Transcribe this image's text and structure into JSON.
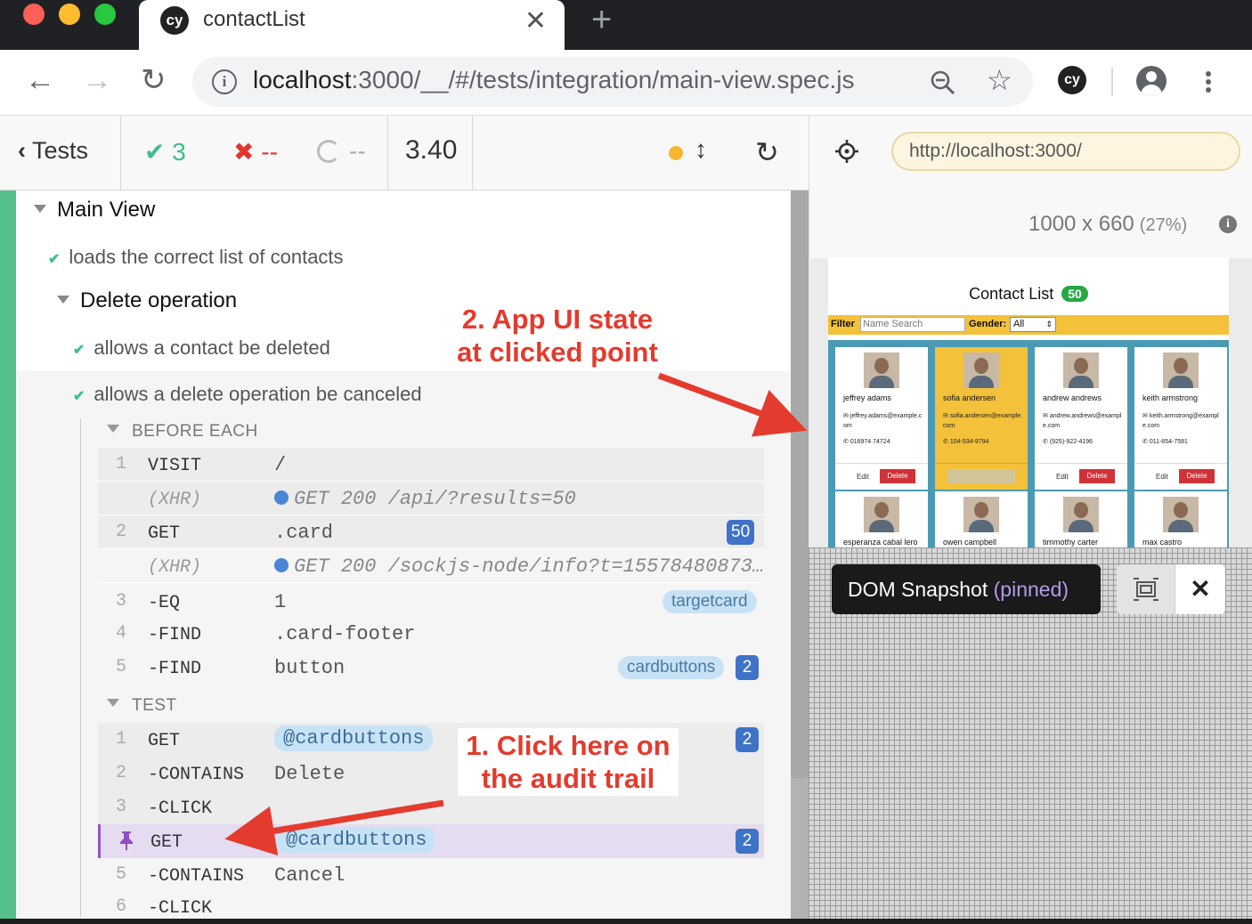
{
  "browser": {
    "tab_title": "contactList",
    "tab_favicon": "cy",
    "tab_close": "✕",
    "new_tab": "+",
    "url_host": "localhost",
    "url_path": ":3000/__/#/tests/integration/main-view.spec.js",
    "extension_label": "cy"
  },
  "runner": {
    "back_label": "Tests",
    "passed": "3",
    "failed": "--",
    "pending": "--",
    "duration": "3.40",
    "suite": "Main View",
    "tests": [
      {
        "title": "loads the correct list of contacts"
      },
      {
        "title": "allows a contact be deleted"
      },
      {
        "title": "allows a delete operation be canceled"
      }
    ],
    "nested_suite": "Delete operation",
    "before_each_label": "BEFORE EACH",
    "test_label": "TEST",
    "before_each_commands": [
      {
        "num": "1",
        "name": "VISIT",
        "message": "/"
      },
      {
        "num": "",
        "name": "(XHR)",
        "message": "GET 200 /api/?results=50"
      },
      {
        "num": "2",
        "name": "GET",
        "message": ".card",
        "badge": "50"
      },
      {
        "num": "",
        "name": "(XHR)",
        "message": "GET 200 /sockjs-node/info?t=15578480873…"
      },
      {
        "num": "3",
        "name": "-EQ",
        "message": "1",
        "alias": "targetcard"
      },
      {
        "num": "4",
        "name": "-FIND",
        "message": ".card-footer"
      },
      {
        "num": "5",
        "name": "-FIND",
        "message": "button",
        "alias": "cardbuttons",
        "badge": "2"
      }
    ],
    "test_commands": [
      {
        "num": "1",
        "name": "GET",
        "message": "@cardbuttons",
        "badge": "2"
      },
      {
        "num": "2",
        "name": "-CONTAINS",
        "message": "Delete"
      },
      {
        "num": "3",
        "name": "-CLICK",
        "message": ""
      },
      {
        "num": "",
        "name": "GET",
        "message": "@cardbuttons",
        "badge": "2",
        "pinned": true
      },
      {
        "num": "5",
        "name": "-CONTAINS",
        "message": "Cancel"
      },
      {
        "num": "6",
        "name": "-CLICK",
        "message": ""
      }
    ]
  },
  "aut": {
    "url": "http://localhost:3000/",
    "viewport": "1000 x 660",
    "scale": "(27%)",
    "snapshot_label": "DOM Snapshot",
    "snapshot_pinned": "(pinned)",
    "app": {
      "title": "Contact List",
      "count": "50",
      "filter_label": "Filter",
      "filter_placeholder": "Name Search",
      "gender_label": "Gender:",
      "gender_value": "All",
      "edit_label": "Edit",
      "delete_label": "Delete",
      "contacts": [
        {
          "name": "jeffrey adams",
          "email": "jeffrey.adams@example.com",
          "phone": "016974 74724"
        },
        {
          "name": "sofia andersen",
          "email": "sofia.andersen@example.com",
          "phone": "104-534-9794",
          "highlighted": true
        },
        {
          "name": "andrew andrews",
          "email": "andrew.andrews@example.com",
          "phone": "(925)-922-4196"
        },
        {
          "name": "keith armstrong",
          "email": "keith.armstrong@example.com",
          "phone": "011-854-7581"
        },
        {
          "name": "esperanza cabal lero"
        },
        {
          "name": "owen campbell"
        },
        {
          "name": "timmothy carter"
        },
        {
          "name": "max castro"
        }
      ]
    }
  },
  "annotations": {
    "app_state_line1": "2. App UI state",
    "app_state_line2": "at clicked point",
    "click_here_line1": "1. Click here on",
    "click_here_line2": "the audit trail",
    "color": "#e33b2e"
  },
  "colors": {
    "pass": "#3dbe8a",
    "fail": "#e3342f",
    "pinned": "#9254c6",
    "card_highlight": "#f3c13a",
    "delete_button": "#d03238"
  }
}
